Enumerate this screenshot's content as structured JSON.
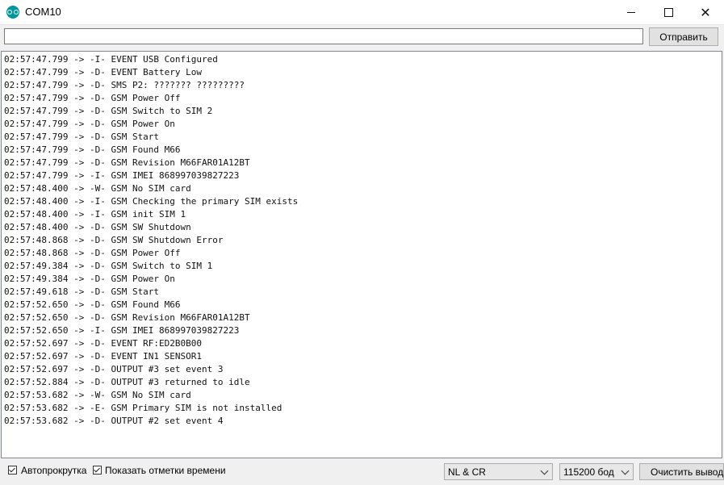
{
  "window": {
    "title": "COM10",
    "app_icon": "arduino-icon"
  },
  "toolbar": {
    "send_input_value": "",
    "send_label": "Отправить"
  },
  "log": [
    "02:57:47.799 -> -I- EVENT USB Configured",
    "02:57:47.799 -> -D- EVENT Battery Low",
    "02:57:47.799 -> -D- SMS P2: ??????? ?????????",
    "02:57:47.799 -> -D- GSM Power Off",
    "02:57:47.799 -> -D- GSM Switch to SIM 2",
    "02:57:47.799 -> -D- GSM Power On",
    "02:57:47.799 -> -D- GSM Start",
    "02:57:47.799 -> -D- GSM Found M66",
    "02:57:47.799 -> -D- GSM Revision M66FAR01A12BT",
    "02:57:47.799 -> -I- GSM IMEI 868997039827223",
    "02:57:48.400 -> -W- GSM No SIM card",
    "02:57:48.400 -> -I- GSM Checking the primary SIM exists",
    "02:57:48.400 -> -I- GSM init SIM 1",
    "02:57:48.400 -> -D- GSM SW Shutdown",
    "02:57:48.868 -> -D- GSM SW Shutdown Error",
    "02:57:48.868 -> -D- GSM Power Off",
    "02:57:49.384 -> -D- GSM Switch to SIM 1",
    "02:57:49.384 -> -D- GSM Power On",
    "02:57:49.618 -> -D- GSM Start",
    "02:57:52.650 -> -D- GSM Found M66",
    "02:57:52.650 -> -D- GSM Revision M66FAR01A12BT",
    "02:57:52.650 -> -I- GSM IMEI 868997039827223",
    "02:57:52.697 -> -D- EVENT RF:ED2B0B00",
    "02:57:52.697 -> -D- EVENT IN1 SENSOR1",
    "02:57:52.697 -> -D- OUTPUT #3 set event 3",
    "02:57:52.884 -> -D- OUTPUT #3 returned to idle",
    "02:57:53.682 -> -W- GSM No SIM card",
    "02:57:53.682 -> -E- GSM Primary SIM is not installed",
    "02:57:53.682 -> -D- OUTPUT #2 set event 4"
  ],
  "bottom": {
    "autoscroll_label": "Автопрокрутка",
    "autoscroll_checked": true,
    "timestamps_label": "Показать отметки времени",
    "timestamps_checked": true,
    "line_ending": "NL & CR",
    "baud": "115200 бод",
    "clear_label": "Очистить вывод"
  }
}
